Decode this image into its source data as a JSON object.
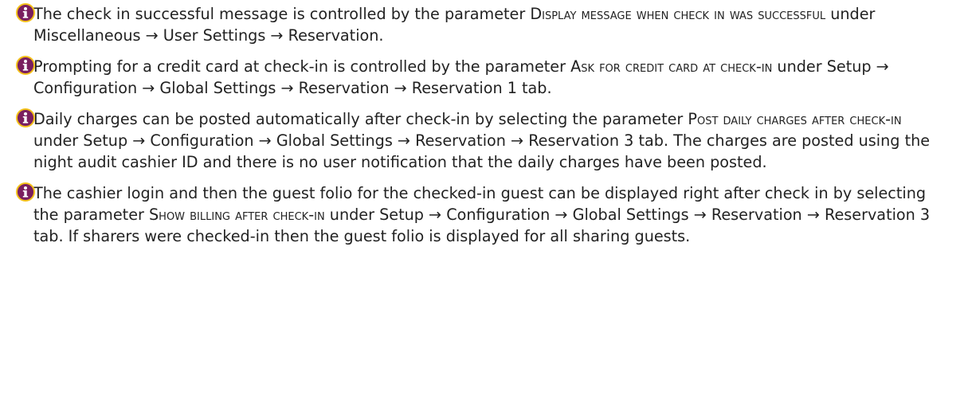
{
  "icon": {
    "name": "info-icon",
    "fill": "#7a1f5f",
    "ring": "#f3c11a",
    "glyph": "i"
  },
  "arrow": "→",
  "notes": [
    {
      "before": "The check in successful message is controlled by the parameter ",
      "param": "Display message when check in was successful",
      "after": " under Miscellaneous → User Settings → Reservation."
    },
    {
      "before": "Prompting for a credit card at check-in is controlled by the parameter ",
      "param": "Ask for credit card at check-in",
      "after": " under Setup → Configuration → Global Settings → Reservation → Reservation 1 tab."
    },
    {
      "before": "Daily charges can be posted automatically after check-in by selecting the parameter ",
      "param": "Post daily charges after check-in",
      "after": " under Setup → Configuration → Global Settings → Reservation → Reservation 3 tab. The charges are posted using the night audit cashier ID and there is no user notification that the daily charges have been posted."
    },
    {
      "before": "The cashier login and then the guest folio for the checked-in guest can be displayed right after check in by selecting the parameter ",
      "param": "Show billing after check-in",
      "after": " under Setup → Configuration → Global Settings → Reservation → Reservation 3 tab. If sharers were checked-in then the guest folio is displayed for all sharing guests."
    }
  ]
}
